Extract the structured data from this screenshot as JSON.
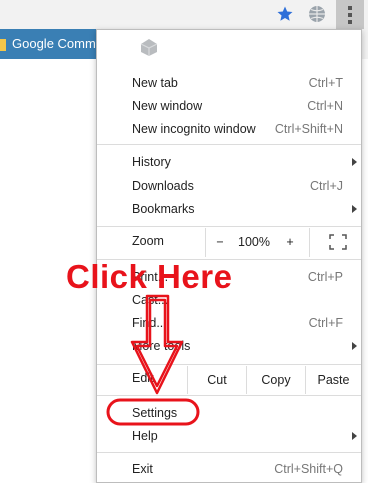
{
  "bookmark_bar": {
    "item_label": "Google Commu"
  },
  "colors": {
    "accent_star": "#2e6fd9",
    "annotation": "#e8131b",
    "bookmark_bg": "#3a7fb4"
  },
  "menu": {
    "new_tab": {
      "label": "New tab",
      "shortcut": "Ctrl+T"
    },
    "new_window": {
      "label": "New window",
      "shortcut": "Ctrl+N"
    },
    "new_incognito": {
      "label": "New incognito window",
      "shortcut": "Ctrl+Shift+N"
    },
    "history": {
      "label": "History"
    },
    "downloads": {
      "label": "Downloads",
      "shortcut": "Ctrl+J"
    },
    "bookmarks": {
      "label": "Bookmarks"
    },
    "zoom": {
      "label": "Zoom",
      "minus": "−",
      "value": "100%",
      "plus": "+"
    },
    "print": {
      "label": "Print...",
      "shortcut": "Ctrl+P"
    },
    "cast": {
      "label": "Cast..."
    },
    "find": {
      "label": "Find...",
      "shortcut": "Ctrl+F"
    },
    "more_tools": {
      "label": "More tools"
    },
    "edit": {
      "label": "Edit",
      "cut": "Cut",
      "copy": "Copy",
      "paste": "Paste"
    },
    "settings": {
      "label": "Settings"
    },
    "help": {
      "label": "Help"
    },
    "exit": {
      "label": "Exit",
      "shortcut": "Ctrl+Shift+Q"
    }
  },
  "annotation": {
    "text": "Click Here"
  }
}
